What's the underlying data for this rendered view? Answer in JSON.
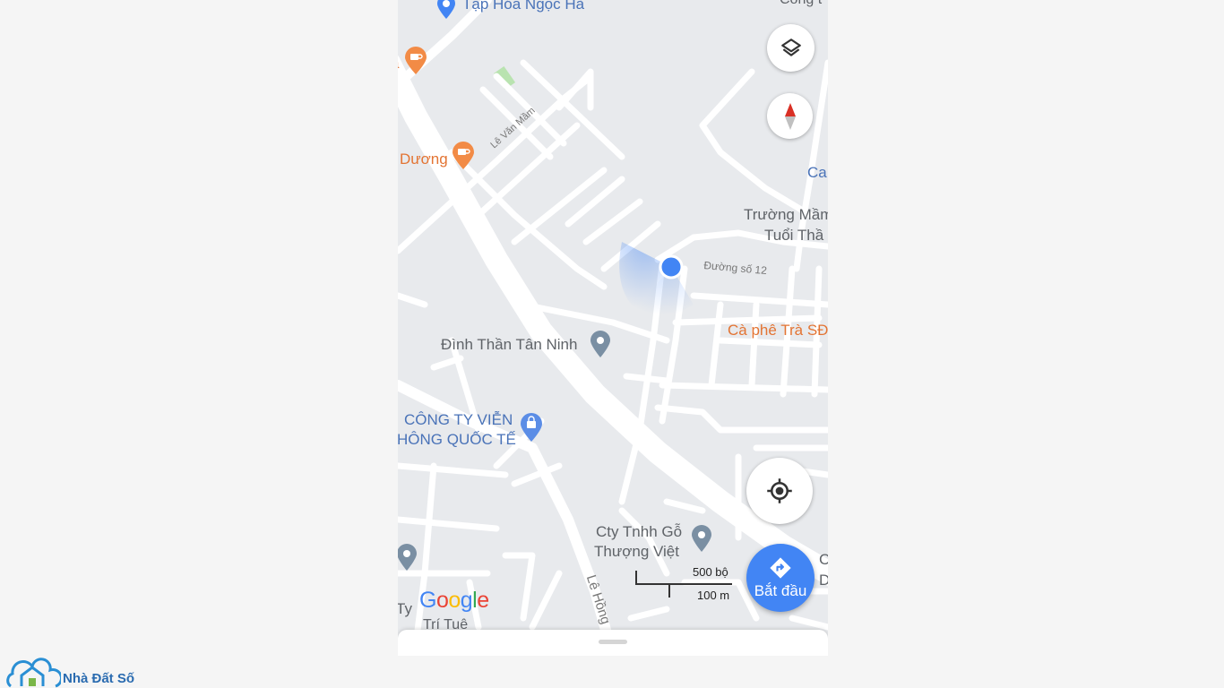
{
  "map": {
    "pois": {
      "tap_hoa": "Tạp Hóa Ngọc Hà",
      "cong_top": "Công t",
      "duong": "Dương",
      "ca": "Ca",
      "truong_mam_1": "Trường Mầm",
      "truong_mam_2": "Tuổi Thầ",
      "ca_phe": "Cà phê Trà SĐ",
      "dinh_than": "Đình Thần Tân Ninh",
      "cong_ty_vien_1": "CÔNG TY VIỄN",
      "cong_ty_vien_2": "HÔNG QUỐC TẾ",
      "cty_go_1": "Cty Tnhh Gỗ",
      "cty_go_2": "Thượng Việt",
      "right_c": "C",
      "right_d": "D",
      "bottom_ty": "Ty",
      "tri_tue": "Trí Tuệ"
    },
    "roads": {
      "le_van_mam": "Lê Văn Mầm",
      "duong_so_12": "Đường số 12",
      "le_hong": "Lê Hồng"
    },
    "scale": {
      "imperial": "500 bộ",
      "metric": "100 m"
    },
    "logo": [
      "G",
      "o",
      "o",
      "g",
      "l",
      "e"
    ],
    "logo_colors": [
      "#4285f4",
      "#ea4335",
      "#fbbc05",
      "#4285f4",
      "#34a853",
      "#ea4335"
    ]
  },
  "controls": {
    "layers_icon": "layers-icon",
    "compass_icon": "compass-icon",
    "my_location_icon": "my-location-icon",
    "start_label": "Bắt đầu",
    "start_icon": "directions-icon"
  },
  "watermark": {
    "brand": "Nhà Đất Số",
    "brand_colors": [
      "#2a6bb0",
      "#2a6bb0",
      "#7ab648"
    ]
  },
  "colors": {
    "accent": "#4285f4",
    "map_bg": "#e8eaed",
    "road": "#ffffff",
    "poi_orange": "#e37433",
    "poi_blue": "#4a73b8",
    "poi_gray": "#5f6368"
  }
}
